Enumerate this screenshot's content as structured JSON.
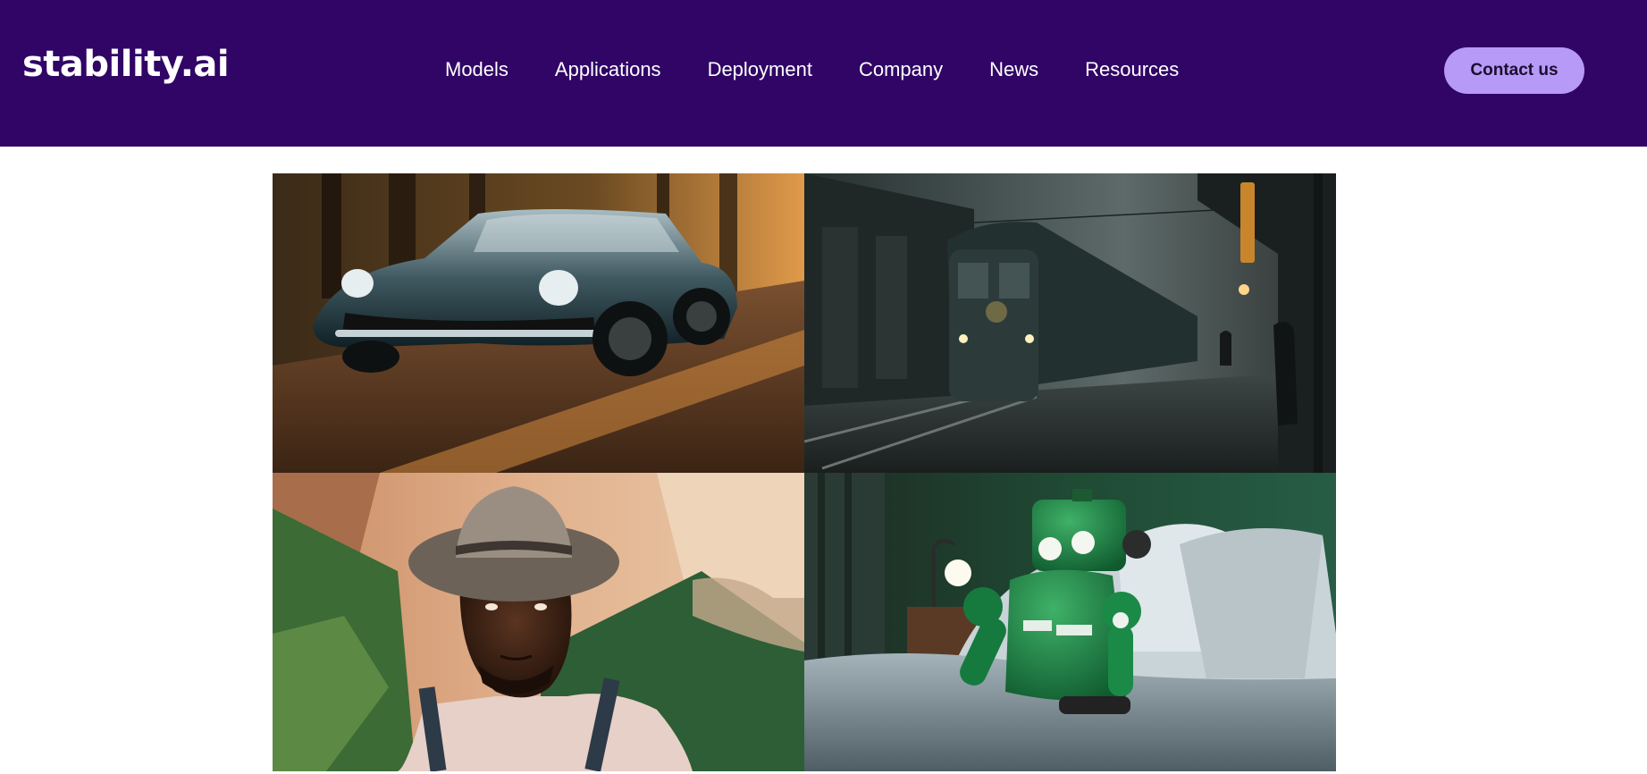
{
  "header": {
    "logo_text": "stability.ai",
    "nav": [
      {
        "label": "Models"
      },
      {
        "label": "Applications"
      },
      {
        "label": "Deployment"
      },
      {
        "label": "Company"
      },
      {
        "label": "News"
      },
      {
        "label": "Resources"
      }
    ],
    "contact_label": "Contact us"
  },
  "colors": {
    "header_bg": "#300566",
    "cta_bg": "#b79af7",
    "page_bg": "#ffffff"
  },
  "gallery": {
    "images": [
      {
        "subject": "classic-convertible-car-on-forest-road"
      },
      {
        "subject": "train-at-foggy-station"
      },
      {
        "subject": "man-in-cowboy-hat-in-canyon"
      },
      {
        "subject": "green-robot-in-bed"
      }
    ]
  }
}
